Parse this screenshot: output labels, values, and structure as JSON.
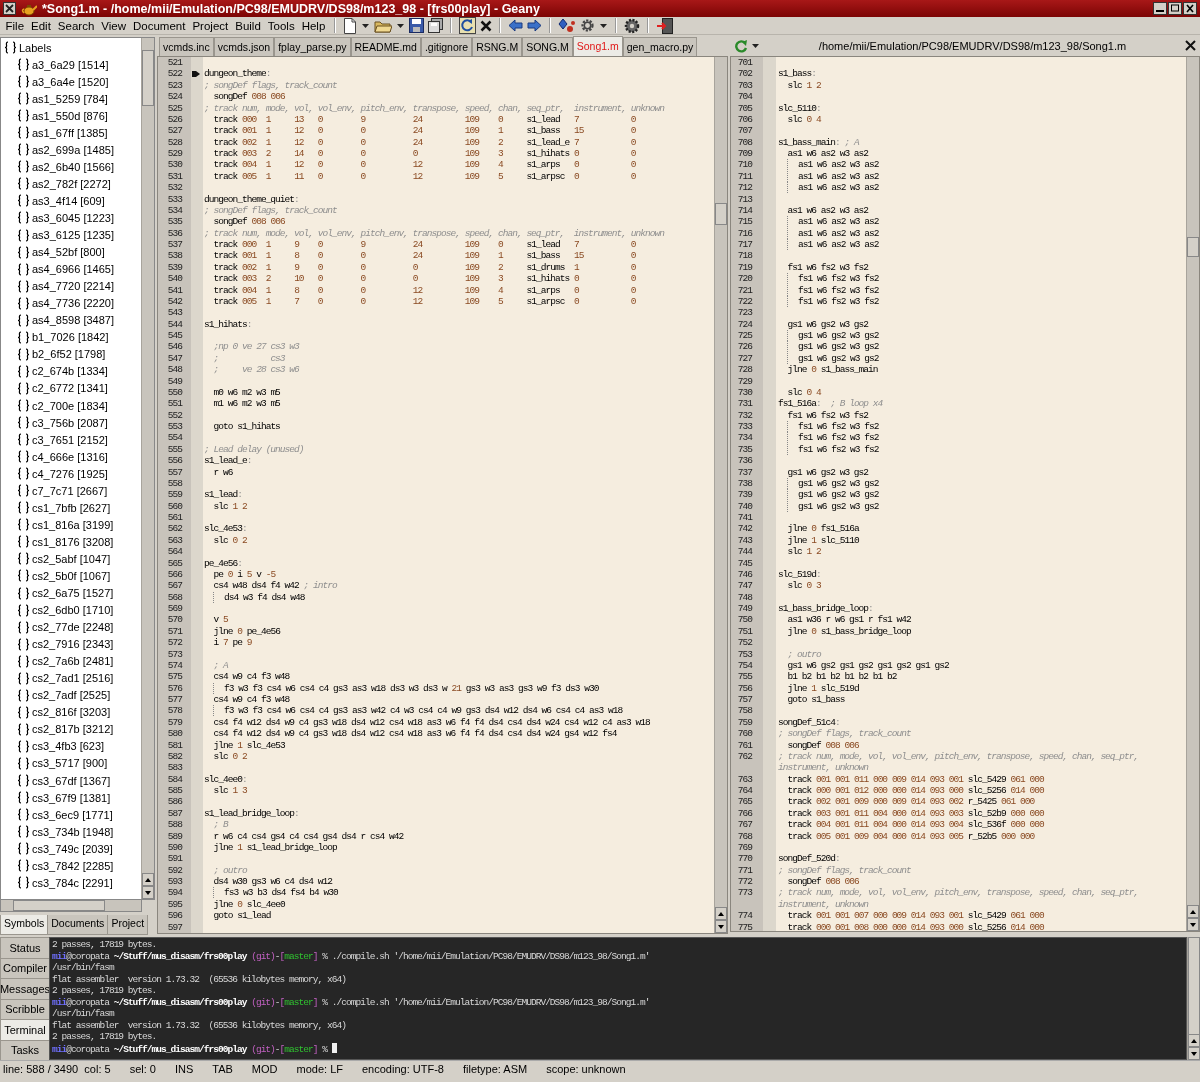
{
  "window": {
    "title": "*Song1.m - /home/mii/Emulation/PC98/EMUDRV/DS98/m123_98 - [frs00play] - Geany"
  },
  "menu": [
    "File",
    "Edit",
    "Search",
    "View",
    "Document",
    "Project",
    "Build",
    "Tools",
    "Help"
  ],
  "sidebar": {
    "tree": [
      {
        "label": "Labels",
        "children": [
          {
            "label": "a3_6a29 [1514]"
          },
          {
            "label": "a3_6a4e [1520]"
          },
          {
            "label": "as1_5259 [784]"
          },
          {
            "label": "as1_550d [876]"
          },
          {
            "label": "as1_67ff [1385]"
          },
          {
            "label": "as2_699a [1485]"
          },
          {
            "label": "as2_6b40 [1566]"
          },
          {
            "label": "as2_782f [2272]"
          },
          {
            "label": "as3_4f14 [609]"
          },
          {
            "label": "as3_6045 [1223]"
          },
          {
            "label": "as3_6125 [1235]"
          },
          {
            "label": "as4_52bf [800]"
          },
          {
            "label": "as4_6966 [1465]"
          },
          {
            "label": "as4_7720 [2214]"
          },
          {
            "label": "as4_7736 [2220]"
          },
          {
            "label": "as4_8598 [3487]"
          },
          {
            "label": "b1_7026 [1842]"
          },
          {
            "label": "b2_6f52 [1798]"
          },
          {
            "label": "c2_674b [1334]"
          },
          {
            "label": "c2_6772 [1341]"
          },
          {
            "label": "c2_700e [1834]"
          },
          {
            "label": "c3_756b [2087]"
          },
          {
            "label": "c3_7651 [2152]"
          },
          {
            "label": "c4_666e [1316]"
          },
          {
            "label": "c4_7276 [1925]"
          },
          {
            "label": "c7_7c71 [2667]"
          },
          {
            "label": "cs1_7bfb [2627]"
          },
          {
            "label": "cs1_816a [3199]"
          },
          {
            "label": "cs1_8176 [3208]"
          },
          {
            "label": "cs2_5abf [1047]"
          },
          {
            "label": "cs2_5b0f [1067]"
          },
          {
            "label": "cs2_6a75 [1527]"
          },
          {
            "label": "cs2_6db0 [1710]"
          },
          {
            "label": "cs2_77de [2248]"
          },
          {
            "label": "cs2_7916 [2343]"
          },
          {
            "label": "cs2_7a6b [2481]"
          },
          {
            "label": "cs2_7ad1 [2516]"
          },
          {
            "label": "cs2_7adf [2525]"
          },
          {
            "label": "cs2_816f [3203]"
          },
          {
            "label": "cs2_817b [3212]"
          },
          {
            "label": "cs3_4fb3 [623]"
          },
          {
            "label": "cs3_5717 [900]"
          },
          {
            "label": "cs3_67df [1367]"
          },
          {
            "label": "cs3_67f9 [1381]"
          },
          {
            "label": "cs3_6ec9 [1771]"
          },
          {
            "label": "cs3_734b [1948]"
          },
          {
            "label": "cs3_749c [2039]"
          },
          {
            "label": "cs3_7842 [2285]"
          },
          {
            "label": "cs3_784c [2291]"
          }
        ]
      }
    ],
    "tabs": [
      {
        "label": "Symbols",
        "selected": true
      },
      {
        "label": "Documents",
        "selected": false
      },
      {
        "label": "Project",
        "selected": false
      }
    ]
  },
  "tabs": [
    {
      "label": "vcmds.inc",
      "selected": false,
      "modified": false
    },
    {
      "label": "vcmds.json",
      "selected": false,
      "modified": false
    },
    {
      "label": "fplay_parse.py",
      "selected": false,
      "modified": false
    },
    {
      "label": "README.md",
      "selected": false,
      "modified": false
    },
    {
      "label": ".gitignore",
      "selected": false,
      "modified": false
    },
    {
      "label": "RSNG.M",
      "selected": false,
      "modified": false
    },
    {
      "label": "SONG.M",
      "selected": false,
      "modified": false
    },
    {
      "label": "Song1.m",
      "selected": true,
      "modified": true
    },
    {
      "label": "gen_macro.py",
      "selected": false,
      "modified": false
    }
  ],
  "editor": {
    "lines": [
      {
        "num": "521",
        "bookmarked": false
      },
      {
        "num": "522",
        "text": "dungeon_theme:",
        "bookmarked": true
      },
      {
        "num": "523",
        "text": "; songDef flags, track_count",
        "bookmarked": false
      },
      {
        "num": "524",
        "text": "  songDef 008 006",
        "bookmarked": false
      },
      {
        "num": "525",
        "text": "; track num, mode, vol, vol_env, pitch_env, transpose, speed, chan, seq_ptr,  instrument, unknown",
        "bookmarked": false
      },
      {
        "num": "526",
        "text": "  track 000  1     13   0        9          24         109    0     s1_lead   7           0",
        "bookmarked": false
      },
      {
        "num": "527",
        "text": "  track 001  1     12   0        0          24         109    1     s1_bass   15          0",
        "bookmarked": false
      },
      {
        "num": "528",
        "text": "  track 002  1     12   0        0          24         109    2     s1_lead_e 7           0",
        "bookmarked": false
      },
      {
        "num": "529",
        "text": "  track 003  2     14   0        0          0          109    3     s1_hihats 0           0",
        "bookmarked": false
      },
      {
        "num": "530",
        "text": "  track 004  1     12   0        0          12         109    4     s1_arps   0           0",
        "bookmarked": false
      },
      {
        "num": "531",
        "text": "  track 005  1     11   0        0          12         109    5     s1_arpsc  0           0",
        "bookmarked": false
      },
      {
        "num": "532",
        "bookmarked": false
      },
      {
        "num": "533",
        "text": "dungeon_theme_quiet:",
        "bookmarked": false
      },
      {
        "num": "534",
        "text": "; songDef flags, track_count",
        "bookmarked": false
      },
      {
        "num": "535",
        "text": "  songDef 008 006",
        "bookmarked": false
      },
      {
        "num": "536",
        "text": "; track num, mode, vol, vol_env, pitch_env, transpose, speed, chan, seq_ptr,  instrument, unknown",
        "bookmarked": false
      },
      {
        "num": "537",
        "text": "  track 000  1     9    0        9          24         109    0     s1_lead   7           0",
        "bookmarked": false
      },
      {
        "num": "538",
        "text": "  track 001  1     8    0        0          24         109    1     s1_bass   15          0",
        "bookmarked": false
      },
      {
        "num": "539",
        "text": "  track 002  1     9    0        0          0          109    2     s1_drums  1           0",
        "bookmarked": false
      },
      {
        "num": "540",
        "text": "  track 003  2     10   0        0          0          109    3     s1_hihats 0           0",
        "bookmarked": false
      },
      {
        "num": "541",
        "text": "  track 004  1     8    0        0          12         109    4     s1_arps   0           0",
        "bookmarked": false
      },
      {
        "num": "542",
        "text": "  track 005  1     7    0        0          12         109    5     s1_arpsc  0           0",
        "bookmarked": false
      },
      {
        "num": "543",
        "bookmarked": false
      },
      {
        "num": "544",
        "text": "s1_hihats:",
        "bookmarked": false
      },
      {
        "num": "545",
        "bookmarked": false
      },
      {
        "num": "546",
        "text": "  ;np 0 ve 27 cs3 w3",
        "bookmarked": false
      },
      {
        "num": "547",
        "text": "  ;           cs3",
        "bookmarked": false
      },
      {
        "num": "548",
        "text": "  ;     ve 28 cs3 w6",
        "bookmarked": false
      },
      {
        "num": "549",
        "bookmarked": false
      },
      {
        "num": "550",
        "text": "  m0 w6 m2 w3 m5",
        "bookmarked": false
      },
      {
        "num": "551",
        "text": "  m1 w6 m2 w3 m5",
        "bookmarked": false
      },
      {
        "num": "552",
        "bookmarked": false
      },
      {
        "num": "553",
        "text": "  goto s1_hihats",
        "bookmarked": false
      },
      {
        "num": "554",
        "bookmarked": false
      },
      {
        "num": "555",
        "text": "; Lead delay (unused)",
        "bookmarked": false
      },
      {
        "num": "556",
        "text": "s1_lead_e:",
        "bookmarked": false
      },
      {
        "num": "557",
        "text": "  r w6",
        "bookmarked": false
      },
      {
        "num": "558",
        "bookmarked": false
      },
      {
        "num": "559",
        "text": "s1_lead:",
        "bookmarked": false
      },
      {
        "num": "560",
        "text": "  slc 1 2",
        "bookmarked": false
      },
      {
        "num": "561",
        "bookmarked": false
      },
      {
        "num": "562",
        "text": "slc_4e53:",
        "bookmarked": false
      },
      {
        "num": "563",
        "text": "  slc 0 2",
        "bookmarked": false
      },
      {
        "num": "564",
        "bookmarked": false
      },
      {
        "num": "565",
        "text": "pe_4e56:",
        "bookmarked": false
      },
      {
        "num": "566",
        "text": "  pe 0 i 5 v -5",
        "bookmarked": false
      },
      {
        "num": "567",
        "text": "  cs4 w48 ds4 f4 w42 ; intro",
        "bookmarked": false
      },
      {
        "num": "568",
        "text": "    ds4 w3 f4 ds4 w48",
        "bookmarked": false
      },
      {
        "num": "569",
        "bookmarked": false
      },
      {
        "num": "570",
        "text": "  v 5",
        "bookmarked": false
      },
      {
        "num": "571",
        "text": "  jlne 0 pe_4e56",
        "bookmarked": false
      },
      {
        "num": "572",
        "text": "  i 7 pe 9",
        "bookmarked": false
      },
      {
        "num": "573",
        "bookmarked": false
      },
      {
        "num": "574",
        "text": "  ; A",
        "bookmarked": false
      },
      {
        "num": "575",
        "text": "  cs4 w9 c4 f3 w48",
        "bookmarked": false
      },
      {
        "num": "576",
        "text": "    f3 w3 f3 cs4 w6 cs4 c4 gs3 as3 w18 ds3 w3 ds3 w 21 gs3 w3 as3 gs3 w9 f3 ds3 w30",
        "bookmarked": false
      },
      {
        "num": "577",
        "text": "  cs4 w9 c4 f3 w48",
        "bookmarked": false
      },
      {
        "num": "578",
        "text": "    f3 w3 f3 cs4 w6 cs4 c4 gs3 as3 w42 c4 w3 cs4 c4 w9 gs3 ds4 w12 ds4 w6 cs4 c4 as3 w18",
        "bookmarked": false
      },
      {
        "num": "579",
        "text": "  cs4 f4 w12 ds4 w9 c4 gs3 w18 ds4 w12 cs4 w18 as3 w6 f4 f4 ds4 cs4 ds4 w24 cs4 w12 c4 as3 w18",
        "bookmarked": false
      },
      {
        "num": "580",
        "text": "  cs4 f4 w12 ds4 w9 c4 gs3 w18 ds4 w12 cs4 w18 as3 w6 f4 f4 ds4 cs4 ds4 w24 gs4 w12 fs4",
        "bookmarked": false
      },
      {
        "num": "581",
        "text": "  jlne 1 slc_4e53",
        "bookmarked": false
      },
      {
        "num": "582",
        "text": "  slc 0 2",
        "bookmarked": false
      },
      {
        "num": "583",
        "bookmarked": false
      },
      {
        "num": "584",
        "text": "slc_4ee0:",
        "bookmarked": false
      },
      {
        "num": "585",
        "text": "  slc 1 3",
        "bookmarked": false
      },
      {
        "num": "586",
        "bookmarked": false
      },
      {
        "num": "587",
        "text": "s1_lead_bridge_loop:",
        "bookmarked": false
      },
      {
        "num": "588",
        "text": "  ; B",
        "bookmarked": false
      },
      {
        "num": "589",
        "text": "  r w6 c4 cs4 gs4 c4 cs4 gs4 ds4 r cs4 w42",
        "bookmarked": false
      },
      {
        "num": "590",
        "text": "  jlne 1 s1_lead_bridge_loop",
        "bookmarked": false
      },
      {
        "num": "591",
        "bookmarked": false
      },
      {
        "num": "592",
        "text": "  ; outro",
        "bookmarked": false
      },
      {
        "num": "593",
        "text": "  ds4 w30 gs3 w6 c4 ds4 w12",
        "bookmarked": false
      },
      {
        "num": "594",
        "text": "    fs3 w3 b3 ds4 fs4 b4 w30",
        "bookmarked": false
      },
      {
        "num": "595",
        "text": "  jlne 0 slc_4ee0",
        "bookmarked": false
      },
      {
        "num": "596",
        "text": "  goto s1_lead",
        "bookmarked": false
      },
      {
        "num": "597",
        "bookmarked": false
      }
    ]
  },
  "split": {
    "path": "/home/mii/Emulation/PC98/EMUDRV/DS98/m123_98/Song1.m",
    "lines": [
      {
        "num": "701"
      },
      {
        "num": "702",
        "text": "s1_bass:"
      },
      {
        "num": "703",
        "text": "  slc 1 2"
      },
      {
        "num": "704"
      },
      {
        "num": "705",
        "text": "slc_5110:"
      },
      {
        "num": "706",
        "text": "  slc 0 4"
      },
      {
        "num": "707"
      },
      {
        "num": "708",
        "text": "s1_bass_main: ; A"
      },
      {
        "num": "709",
        "text": "  as1 w6 as2 w3 as2"
      },
      {
        "num": "710",
        "text": "    as1 w6 as2 w3 as2"
      },
      {
        "num": "711",
        "text": "    as1 w6 as2 w3 as2"
      },
      {
        "num": "712",
        "text": "    as1 w6 as2 w3 as2"
      },
      {
        "num": "713"
      },
      {
        "num": "714",
        "text": "  as1 w6 as2 w3 as2"
      },
      {
        "num": "715",
        "text": "    as1 w6 as2 w3 as2"
      },
      {
        "num": "716",
        "text": "    as1 w6 as2 w3 as2"
      },
      {
        "num": "717",
        "text": "    as1 w6 as2 w3 as2"
      },
      {
        "num": "718"
      },
      {
        "num": "719",
        "text": "  fs1 w6 fs2 w3 fs2"
      },
      {
        "num": "720",
        "text": "    fs1 w6 fs2 w3 fs2"
      },
      {
        "num": "721",
        "text": "    fs1 w6 fs2 w3 fs2"
      },
      {
        "num": "722",
        "text": "    fs1 w6 fs2 w3 fs2"
      },
      {
        "num": "723"
      },
      {
        "num": "724",
        "text": "  gs1 w6 gs2 w3 gs2"
      },
      {
        "num": "725",
        "text": "    gs1 w6 gs2 w3 gs2"
      },
      {
        "num": "726",
        "text": "    gs1 w6 gs2 w3 gs2"
      },
      {
        "num": "727",
        "text": "    gs1 w6 gs2 w3 gs2"
      },
      {
        "num": "728",
        "text": "  jlne 0 s1_bass_main"
      },
      {
        "num": "729"
      },
      {
        "num": "730",
        "text": "  slc 0 4"
      },
      {
        "num": "731",
        "text": "fs1_516a:  ; B loop x4"
      },
      {
        "num": "732",
        "text": "  fs1 w6 fs2 w3 fs2"
      },
      {
        "num": "733",
        "text": "    fs1 w6 fs2 w3 fs2"
      },
      {
        "num": "734",
        "text": "    fs1 w6 fs2 w3 fs2"
      },
      {
        "num": "735",
        "text": "    fs1 w6 fs2 w3 fs2"
      },
      {
        "num": "736"
      },
      {
        "num": "737",
        "text": "  gs1 w6 gs2 w3 gs2"
      },
      {
        "num": "738",
        "text": "    gs1 w6 gs2 w3 gs2"
      },
      {
        "num": "739",
        "text": "    gs1 w6 gs2 w3 gs2"
      },
      {
        "num": "740",
        "text": "    gs1 w6 gs2 w3 gs2"
      },
      {
        "num": "741"
      },
      {
        "num": "742",
        "text": "  jlne 0 fs1_516a"
      },
      {
        "num": "743",
        "text": "  jlne 1 slc_5110"
      },
      {
        "num": "744",
        "text": "  slc 1 2"
      },
      {
        "num": "745"
      },
      {
        "num": "746",
        "text": "slc_519d:"
      },
      {
        "num": "747",
        "text": "  slc 0 3"
      },
      {
        "num": "748"
      },
      {
        "num": "749",
        "text": "s1_bass_bridge_loop:"
      },
      {
        "num": "750",
        "text": "  as1 w36 r w6 gs1 r fs1 w42"
      },
      {
        "num": "751",
        "text": "  jlne 0 s1_bass_bridge_loop"
      },
      {
        "num": "752"
      },
      {
        "num": "753",
        "text": "  ; outro"
      },
      {
        "num": "754",
        "text": "  gs1 w6 gs2 gs1 gs2 gs1 gs2 gs1 gs2"
      },
      {
        "num": "755",
        "text": "  b1 b2 b1 b2 b1 b2 b1 b2"
      },
      {
        "num": "756",
        "text": "  jlne 1 slc_519d"
      },
      {
        "num": "757",
        "text": "  goto s1_bass"
      },
      {
        "num": "758"
      },
      {
        "num": "759",
        "text": "songDef_51c4:"
      },
      {
        "num": "760",
        "text": "; songDef flags, track_count"
      },
      {
        "num": "761",
        "text": "  songDef 008 006"
      },
      {
        "num": "762",
        "text": "; track num, mode, vol, vol_env, pitch_env, transpose, speed, chan, seq_ptr, instrument, unknown"
      },
      {
        "num": "763",
        "text": "  track 001 001 011 000 009 014 093 001 slc_5429 061 000"
      },
      {
        "num": "764",
        "text": "  track 000 001 012 000 000 014 093 000 slc_5256 014 000"
      },
      {
        "num": "765",
        "text": "  track 002 001 009 000 009 014 093 002 r_5425 061 000"
      },
      {
        "num": "766",
        "text": "  track 003 001 011 004 000 014 093 003 slc_52b9 000 000"
      },
      {
        "num": "767",
        "text": "  track 004 001 011 004 000 014 093 004 slc_536f 000 000"
      },
      {
        "num": "768",
        "text": "  track 005 001 009 004 000 014 093 005 r_52b5 000 000"
      },
      {
        "num": "769"
      },
      {
        "num": "770",
        "text": "songDef_520d:"
      },
      {
        "num": "771",
        "text": "; songDef flags, track_count"
      },
      {
        "num": "772",
        "text": "  songDef 008 006"
      },
      {
        "num": "773",
        "text": "; track num, mode, vol, vol_env, pitch_env, transpose, speed, chan, seq_ptr, instrument, unknown"
      },
      {
        "num": "774",
        "text": "  track 001 001 007 000 009 014 093 001 slc_5429 061 000"
      },
      {
        "num": "775",
        "text": "  track 000 001 008 000 000 014 093 000 slc_5256 014 000"
      }
    ]
  },
  "messages": {
    "tabs": [
      {
        "label": "Status",
        "selected": false
      },
      {
        "label": "Compiler",
        "selected": false
      },
      {
        "label": "Messages",
        "selected": false
      },
      {
        "label": "Scribble",
        "selected": false
      },
      {
        "label": "Terminal",
        "selected": true
      },
      {
        "label": "Tasks",
        "selected": false
      }
    ],
    "terminal": [
      {
        "cursor": false,
        "segments": [
          {
            "kind": "plain",
            "text": "2 passes, 17819 bytes."
          }
        ]
      },
      {
        "cursor": false,
        "segments": [
          {
            "kind": "user",
            "text": "mii"
          },
          {
            "kind": "plain",
            "text": "@coropata "
          },
          {
            "kind": "path",
            "text": "~/Stuff/mus_disasm/frs00play"
          },
          {
            "kind": "git",
            "text": " (git)"
          },
          {
            "kind": "plain",
            "text": "-"
          },
          {
            "kind": "git",
            "text": "["
          },
          {
            "kind": "branch",
            "text": "master"
          },
          {
            "kind": "git",
            "text": "]"
          },
          {
            "kind": "plain",
            "text": " % ./compile.sh '/home/mii/Emulation/PC98/EMUDRV/DS98/m123_98/Song1.m'"
          }
        ]
      },
      {
        "cursor": false,
        "segments": [
          {
            "kind": "plain",
            "text": "/usr/bin/fasm"
          }
        ]
      },
      {
        "cursor": false,
        "segments": [
          {
            "kind": "plain",
            "text": "flat assembler  version 1.73.32  (65536 kilobytes memory, x64)"
          }
        ]
      },
      {
        "cursor": false,
        "segments": [
          {
            "kind": "plain",
            "text": "2 passes, 17819 bytes."
          }
        ]
      },
      {
        "cursor": false,
        "segments": [
          {
            "kind": "user",
            "text": "mii"
          },
          {
            "kind": "plain",
            "text": "@coropata "
          },
          {
            "kind": "path",
            "text": "~/Stuff/mus_disasm/frs00play"
          },
          {
            "kind": "git",
            "text": " (git)"
          },
          {
            "kind": "plain",
            "text": "-"
          },
          {
            "kind": "git",
            "text": "["
          },
          {
            "kind": "branch",
            "text": "master"
          },
          {
            "kind": "git",
            "text": "]"
          },
          {
            "kind": "plain",
            "text": " % ./compile.sh '/home/mii/Emulation/PC98/EMUDRV/DS98/m123_98/Song1.m'"
          }
        ]
      },
      {
        "cursor": false,
        "segments": [
          {
            "kind": "plain",
            "text": "/usr/bin/fasm"
          }
        ]
      },
      {
        "cursor": false,
        "segments": [
          {
            "kind": "plain",
            "text": "flat assembler  version 1.73.32  (65536 kilobytes memory, x64)"
          }
        ]
      },
      {
        "cursor": false,
        "segments": [
          {
            "kind": "plain",
            "text": "2 passes, 17819 bytes."
          }
        ]
      },
      {
        "cursor": true,
        "segments": [
          {
            "kind": "user",
            "text": "mii"
          },
          {
            "kind": "plain",
            "text": "@coropata "
          },
          {
            "kind": "path",
            "text": "~/Stuff/mus_disasm/frs00play"
          },
          {
            "kind": "git",
            "text": " (git)"
          },
          {
            "kind": "plain",
            "text": "-"
          },
          {
            "kind": "git",
            "text": "["
          },
          {
            "kind": "branch",
            "text": "master"
          },
          {
            "kind": "git",
            "text": "]"
          },
          {
            "kind": "plain",
            "text": " %"
          }
        ]
      }
    ]
  },
  "status_bar": [
    "line: 588 / 3490  col: 5",
    "sel: 0",
    "INS",
    "TAB",
    "MOD",
    "mode: LF",
    "encoding: UTF-8",
    "filetype: ASM",
    "scope: unknown"
  ]
}
